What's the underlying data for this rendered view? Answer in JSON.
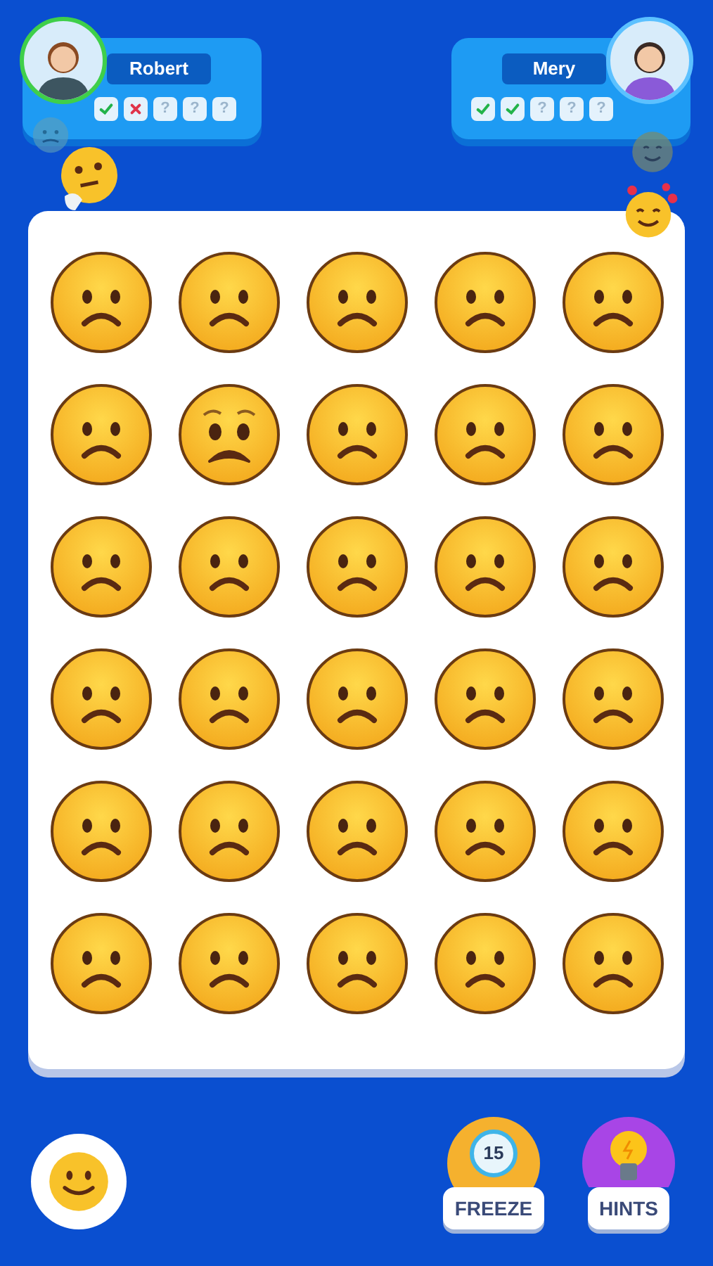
{
  "players": [
    {
      "name": "Robert",
      "active": true,
      "results": [
        {
          "kind": "correct"
        },
        {
          "kind": "wrong"
        },
        {
          "kind": "pending",
          "label": "?"
        },
        {
          "kind": "pending",
          "label": "?"
        },
        {
          "kind": "pending",
          "label": "?"
        }
      ]
    },
    {
      "name": "Mery",
      "active": false,
      "results": [
        {
          "kind": "correct"
        },
        {
          "kind": "correct"
        },
        {
          "kind": "pending",
          "label": "?"
        },
        {
          "kind": "pending",
          "label": "?"
        },
        {
          "kind": "pending",
          "label": "?"
        }
      ]
    }
  ],
  "board": {
    "faces": [
      {
        "kind": "frown"
      },
      {
        "kind": "frown"
      },
      {
        "kind": "frown"
      },
      {
        "kind": "frown"
      },
      {
        "kind": "frown"
      },
      {
        "kind": "frown"
      },
      {
        "kind": "worried"
      },
      {
        "kind": "frown"
      },
      {
        "kind": "frown"
      },
      {
        "kind": "frown"
      },
      {
        "kind": "frown"
      },
      {
        "kind": "frown"
      },
      {
        "kind": "frown"
      },
      {
        "kind": "frown"
      },
      {
        "kind": "frown"
      },
      {
        "kind": "frown"
      },
      {
        "kind": "frown"
      },
      {
        "kind": "frown"
      },
      {
        "kind": "frown"
      },
      {
        "kind": "frown"
      },
      {
        "kind": "frown"
      },
      {
        "kind": "frown"
      },
      {
        "kind": "frown"
      },
      {
        "kind": "frown"
      },
      {
        "kind": "frown"
      },
      {
        "kind": "frown"
      },
      {
        "kind": "frown"
      },
      {
        "kind": "frown"
      },
      {
        "kind": "frown"
      },
      {
        "kind": "frown"
      }
    ]
  },
  "boosters": [
    {
      "kind": "freeze",
      "label": "FREEZE",
      "timer": "15"
    },
    {
      "kind": "hints",
      "label": "HINTS"
    }
  ]
}
